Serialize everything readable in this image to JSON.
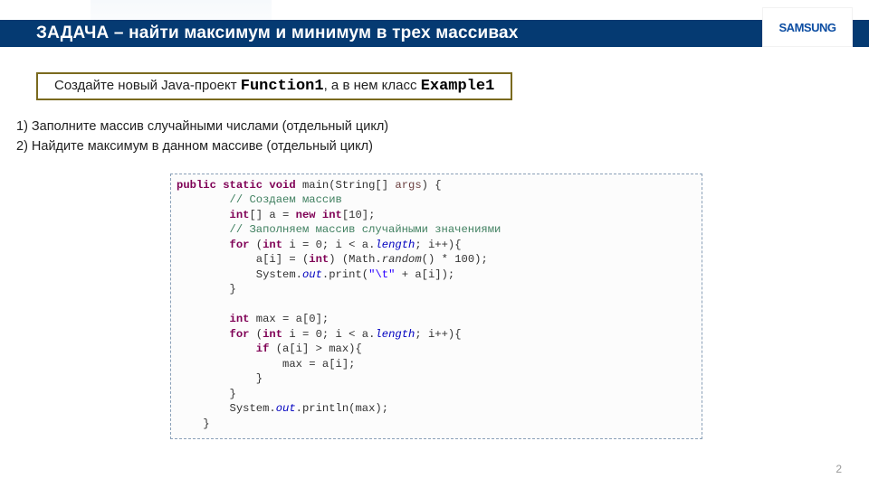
{
  "header": {
    "title": "ЗАДАЧА – найти максимум и минимум в трех массивах",
    "logo": "SAMSUNG"
  },
  "instruction": {
    "prefix": "Создайте новый Java-проект ",
    "fn": "Function1",
    "mid": ", а в нем класс ",
    "cls": "Example1"
  },
  "steps": {
    "s1": "1)   Заполните массив случайными числами (отдельный цикл)",
    "s2": "2)   Найдите максимум в данном массиве (отдельный цикл)"
  },
  "code": {
    "l1a": "public static void",
    "l1b": " main(String[] ",
    "l1c": "args",
    "l1d": ") {",
    "l2": "        // Создаем массив",
    "l3a": "        int",
    "l3b": "[] a = ",
    "l3c": "new int",
    "l3d": "[10];",
    "l4": "        // Заполняем массив случайными значениями",
    "l5a": "        for",
    "l5b": " (",
    "l5c": "int",
    "l5d": " i = 0; i < a.",
    "l5e": "length",
    "l5f": "; i++){",
    "l6a": "            a[i] = (",
    "l6b": "int",
    "l6c": ") (Math.",
    "l6d": "random",
    "l6e": "() * 100);",
    "l7a": "            System.",
    "l7b": "out",
    "l7c": ".print(",
    "l7d": "\"\\t\"",
    "l7e": " + a[i]);",
    "l8": "        }",
    "l9": "",
    "l10a": "        int",
    "l10b": " max = a[0];",
    "l11a": "        for",
    "l11b": " (",
    "l11c": "int",
    "l11d": " i = 0; i < a.",
    "l11e": "length",
    "l11f": "; i++){",
    "l12a": "            if",
    "l12b": " (a[i] > max){",
    "l13": "                max = a[i];",
    "l14": "            }",
    "l15": "        }",
    "l16a": "        System.",
    "l16b": "out",
    "l16c": ".println(max);",
    "l17": "    }"
  },
  "page": "2"
}
